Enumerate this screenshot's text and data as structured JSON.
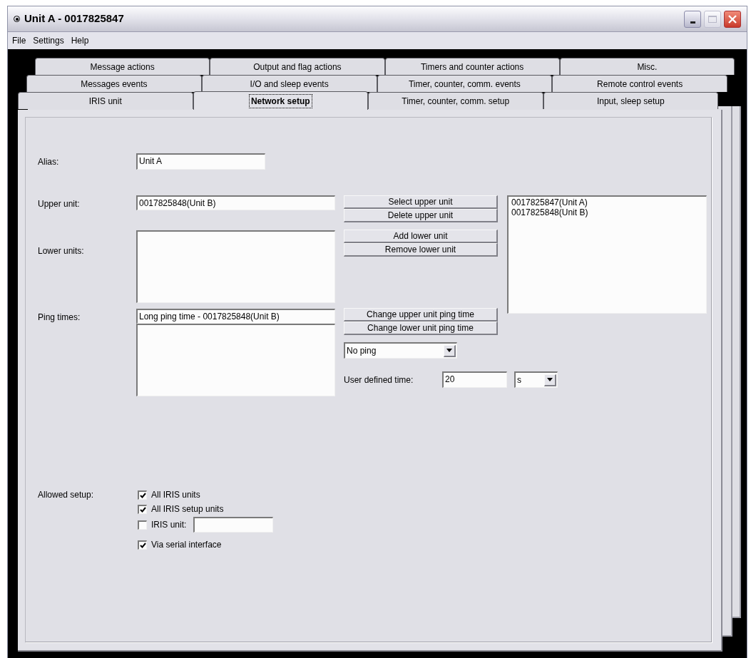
{
  "window": {
    "title": "Unit A - 0017825847"
  },
  "menu": [
    "File",
    "Settings",
    "Help"
  ],
  "tab_rows": [
    [
      {
        "label": "Message actions",
        "selected": false
      },
      {
        "label": "Output and flag actions",
        "selected": false
      },
      {
        "label": "Timers and counter actions",
        "selected": false
      },
      {
        "label": "Misc.",
        "selected": false
      }
    ],
    [
      {
        "label": "Messages events",
        "selected": false
      },
      {
        "label": "I/O and sleep events",
        "selected": false
      },
      {
        "label": "Timer, counter, comm. events",
        "selected": false
      },
      {
        "label": "Remote control events",
        "selected": false
      }
    ],
    [
      {
        "label": "IRIS unit",
        "selected": false
      },
      {
        "label": "Network setup",
        "selected": true
      },
      {
        "label": "Timer, counter, comm. setup",
        "selected": false
      },
      {
        "label": "Input, sleep setup",
        "selected": false
      }
    ]
  ],
  "alias": {
    "label": "Alias:",
    "value": "Unit A"
  },
  "upper_unit": {
    "label": "Upper unit:",
    "value": "0017825848(Unit B)",
    "buttons": [
      "Select upper unit",
      "Delete upper unit"
    ]
  },
  "lower_units": {
    "label": "Lower units:",
    "buttons": [
      "Add lower unit",
      "Remove lower unit"
    ]
  },
  "unit_list": {
    "items": [
      "0017825847(Unit A)",
      "0017825848(Unit B)"
    ]
  },
  "ping_times": {
    "label": "Ping times:",
    "value": "Long ping time - 0017825848(Unit B)",
    "buttons": [
      "Change upper unit ping time",
      "Change lower unit ping time"
    ],
    "mode": "No ping"
  },
  "user_defined_time": {
    "label": "User defined time:",
    "value": "20",
    "unit": "s"
  },
  "allowed_setup": {
    "label": "Allowed setup:",
    "options": [
      {
        "kind": "checkbox",
        "label": "All IRIS units",
        "checked": true
      },
      {
        "kind": "checkbox",
        "label": "All IRIS setup units",
        "checked": true
      },
      {
        "kind": "checkbox_field",
        "label": "IRIS unit:",
        "checked": false
      },
      {
        "kind": "checkbox",
        "label": "Via serial interface",
        "checked": true
      }
    ]
  }
}
